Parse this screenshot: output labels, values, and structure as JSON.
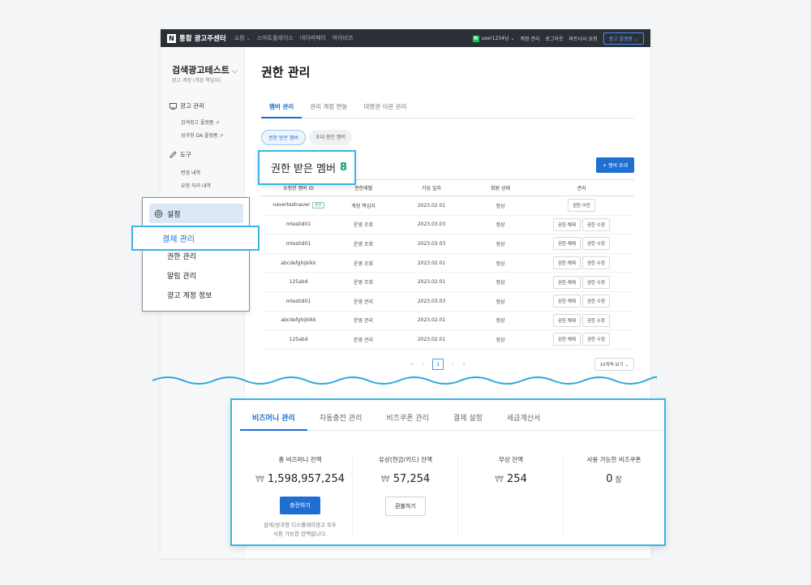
{
  "topnav": {
    "logo": "N",
    "brand": "통합 광고주센터",
    "menu": [
      "쇼핑",
      "스마트플레이스",
      "네이버페이",
      "마이비즈"
    ],
    "n_badge": "N",
    "user": "user1234님",
    "links": [
      "계정 관리",
      "로그아웃",
      "파트너사 요청"
    ],
    "platform_button": "광고 플랫폼"
  },
  "sidebar": {
    "account_name": "검색광고테스트",
    "account_role": "광고 계정 (계정 책임자)",
    "groups": [
      {
        "label": "광고 관리",
        "items": [
          "검색광고 플랫폼 ↗",
          "성과형 DA 플랫폼 ↗"
        ]
      },
      {
        "label": "도구",
        "items": [
          "변경 내역",
          "요청 처리 내역"
        ]
      }
    ]
  },
  "main": {
    "page_title": "권한 관리",
    "tabs": [
      "멤버 관리",
      "관리 계정 연동",
      "대행권 이관 관리"
    ],
    "pills": [
      "권한 받은 멤버",
      "초대 중인 멤버"
    ],
    "invite_button": "+ 멤버 초대",
    "table": {
      "headers": [
        "요청한 멤버 ID",
        "권한레벨",
        "가입 일자",
        "회원 상태",
        "관리"
      ],
      "rows": [
        {
          "id": "navertestnaver",
          "badge": "본인",
          "level": "계정 책임자",
          "date": "2023.02.01",
          "status": "정상",
          "actions": [
            "권한 이전"
          ]
        },
        {
          "id": "mtestid01",
          "badge": "",
          "level": "운영 조회",
          "date": "2023.03.03",
          "status": "정상",
          "actions": [
            "권한 해제",
            "권한 수정"
          ]
        },
        {
          "id": "mtestid01",
          "badge": "",
          "level": "운영 조회",
          "date": "2023.03.03",
          "status": "정상",
          "actions": [
            "권한 해제",
            "권한 수정"
          ]
        },
        {
          "id": "abcdefghijklkk",
          "badge": "",
          "level": "운영 조회",
          "date": "2023.02.01",
          "status": "정상",
          "actions": [
            "권한 해제",
            "권한 수정"
          ]
        },
        {
          "id": "125abd",
          "badge": "",
          "level": "운영 조회",
          "date": "2023.02.01",
          "status": "정상",
          "actions": [
            "권한 해제",
            "권한 수정"
          ]
        },
        {
          "id": "mtestid01",
          "badge": "",
          "level": "운영 관리",
          "date": "2023.03.03",
          "status": "정상",
          "actions": [
            "권한 해제",
            "권한 수정"
          ]
        },
        {
          "id": "abcdefghijklkk",
          "badge": "",
          "level": "운영 관리",
          "date": "2023.02.01",
          "status": "정상",
          "actions": [
            "권한 해제",
            "권한 수정"
          ]
        },
        {
          "id": "125abd",
          "badge": "",
          "level": "운영 관리",
          "date": "2023.02.01",
          "status": "정상",
          "actions": [
            "권한 해제",
            "권한 수정"
          ]
        }
      ]
    },
    "pagination": {
      "first": "«",
      "prev": "‹",
      "current": "1",
      "next": "›",
      "last": "»"
    },
    "page_size": "10개씩 보기"
  },
  "highlight_title": {
    "label": "권한 받은 멤버",
    "count": "8"
  },
  "settings_popup": {
    "header": "설정",
    "items": [
      "결제 관리",
      "권한 관리",
      "알림 관리",
      "광고 계정 정보"
    ]
  },
  "bizmoney": {
    "tabs": [
      "비즈머니 관리",
      "자동충전 관리",
      "비즈쿠폰 관리",
      "결제 설정",
      "세금계산서"
    ],
    "currency": "₩",
    "columns": [
      {
        "label": "총 비즈머니 잔액",
        "value": "1,598,957,254",
        "unit": ""
      },
      {
        "label": "유상(현금/카드) 잔액",
        "value": "57,254",
        "unit": ""
      },
      {
        "label": "무상 잔액",
        "value": "254",
        "unit": ""
      },
      {
        "label": "사용 가능한 비즈쿠폰",
        "value": "0",
        "unit": "장"
      }
    ],
    "charge_button": "충전하기",
    "refund_button": "환불하기",
    "note_line1": "검색/성과형 디스플레이광고 모두",
    "note_line2": "사용 가능한 잔액입니다."
  },
  "colors": {
    "accent": "#1f6ed4",
    "highlight_border": "#3ab5e6",
    "count_green": "#00a36a",
    "nav_bg": "#2b2f36"
  }
}
